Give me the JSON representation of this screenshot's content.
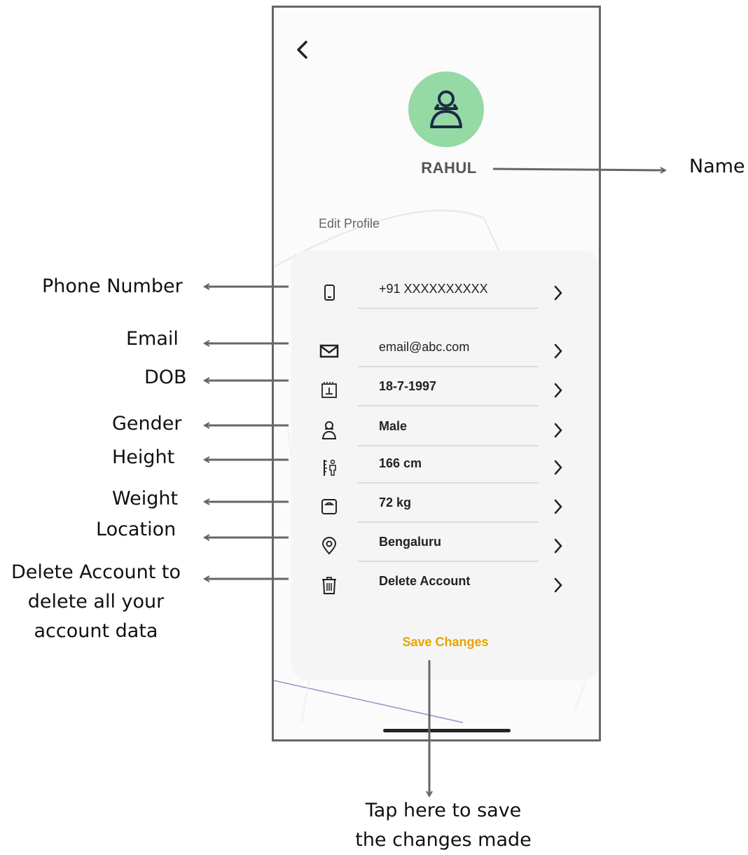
{
  "profile": {
    "name": "RAHUL",
    "section_title": "Edit Profile",
    "avatar_icon": "user-icon",
    "avatar_color": "#95d9a5"
  },
  "fields": [
    {
      "id": "phone",
      "icon": "phone-icon",
      "value": "+91 XXXXXXXXXX"
    },
    {
      "id": "email",
      "icon": "mail-icon",
      "value": "email@abc.com"
    },
    {
      "id": "dob",
      "icon": "calendar-icon",
      "value": "18-7-1997"
    },
    {
      "id": "gender",
      "icon": "user-icon",
      "value": "Male"
    },
    {
      "id": "height",
      "icon": "height-icon",
      "value": "166 cm"
    },
    {
      "id": "weight",
      "icon": "scale-icon",
      "value": "72 kg"
    },
    {
      "id": "location",
      "icon": "location-pin-icon",
      "value": "Bengaluru"
    },
    {
      "id": "delete",
      "icon": "trash-icon",
      "value": "Delete Account"
    }
  ],
  "save_label": "Save Changes",
  "accent_color": "#e6a500",
  "annotations": {
    "name": "Name",
    "phone": "Phone Number",
    "email": "Email",
    "dob": "DOB",
    "gender": "Gender",
    "height": "Height",
    "weight": "Weight",
    "location": "Location",
    "delete_line1": "Delete Account to",
    "delete_line2": "delete all your",
    "delete_line3": "account data",
    "save_line1": "Tap here to save",
    "save_line2": "the changes made"
  }
}
